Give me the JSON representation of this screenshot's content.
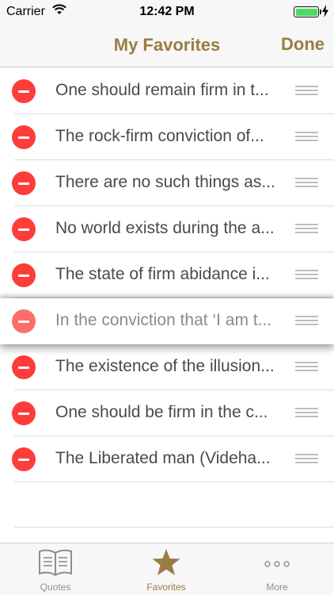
{
  "status_bar": {
    "carrier": "Carrier",
    "time": "12:42 PM",
    "battery_level": 1.0,
    "battery_color": "#4cd964"
  },
  "nav": {
    "title": "My Favorites",
    "done_label": "Done",
    "accent_color": "#9a7c45"
  },
  "favorites": [
    {
      "text": "One should remain firm in t..."
    },
    {
      "text": "The rock-firm conviction of..."
    },
    {
      "text": "There are no such things as..."
    },
    {
      "text": "No world exists during the a..."
    },
    {
      "text": "The state of firm abidance i..."
    },
    {
      "text": "In the conviction that ‘I am t...",
      "state": "dragging"
    },
    {
      "text": "The existence of the illusion..."
    },
    {
      "text": "One should be firm in the c..."
    },
    {
      "text": "The Liberated man (Videha..."
    }
  ],
  "row_icons": {
    "delete": "minus-circle-icon",
    "reorder": "reorder-handle-icon"
  },
  "tabs": [
    {
      "label": "Quotes",
      "icon": "book-icon",
      "selected": false
    },
    {
      "label": "Favorites",
      "icon": "star-icon",
      "selected": true
    },
    {
      "label": "More",
      "icon": "ellipsis-icon",
      "selected": false
    }
  ]
}
